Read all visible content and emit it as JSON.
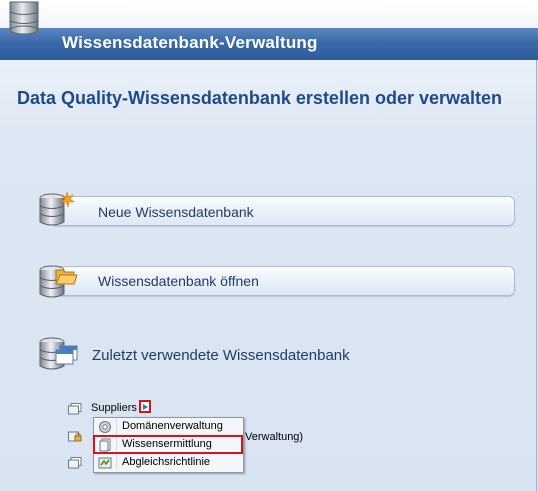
{
  "header": {
    "title": "Wissensdatenbank-Verwaltung",
    "icon": "database-icon"
  },
  "page": {
    "heading": "Data Quality-Wissensdatenbank erstellen oder verwalten"
  },
  "actions": [
    {
      "label": "Neue Wissensdatenbank",
      "icon": "new-database-icon"
    },
    {
      "label": "Wissensdatenbank öffnen",
      "icon": "open-database-icon"
    }
  ],
  "recent": {
    "title": "Zuletzt verwendete Wissensdatenbank",
    "icon": "recent-database-icon",
    "items": [
      {
        "name": "Suppliers",
        "icon": "knowledge-base-icon"
      },
      {
        "partial_text": "Verwaltung)",
        "icon": "locked-knowledge-base-icon"
      },
      {
        "icon": "knowledge-base-icon"
      }
    ]
  },
  "context_menu": {
    "items": [
      {
        "label": "Domänenverwaltung",
        "icon": "gear-icon"
      },
      {
        "label": "Wissensermittlung",
        "icon": "document-icon"
      },
      {
        "label": "Abgleichsrichtlinie",
        "icon": "matching-policy-icon"
      }
    ]
  },
  "colors": {
    "header": "#3b6aa8",
    "heading": "#1e4a8a",
    "highlight": "#d7141a"
  }
}
